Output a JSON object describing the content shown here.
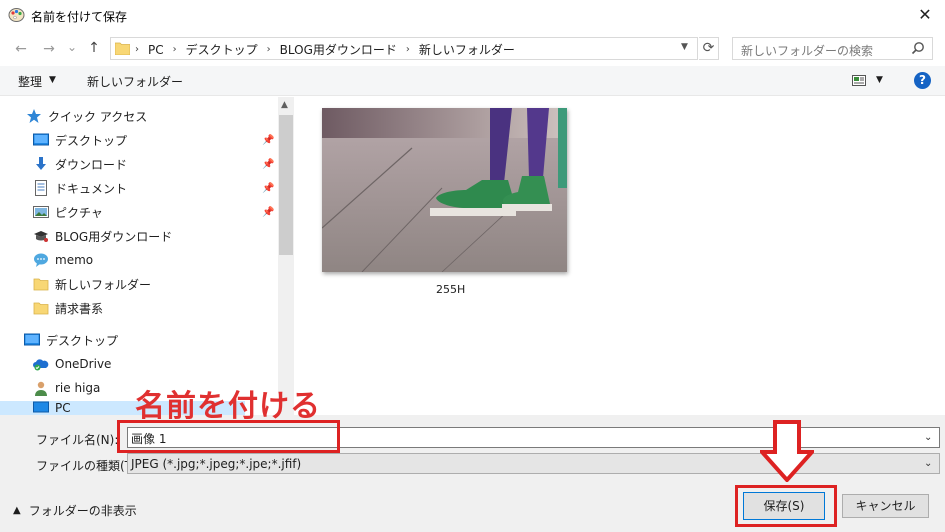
{
  "window": {
    "title": "名前を付けて保存",
    "close_glyph": "✕"
  },
  "nav": {
    "back_glyph": "←",
    "forward_glyph": "→",
    "recent_glyph": "⌄",
    "up_glyph": "↑",
    "address": {
      "crumbs": [
        "PC",
        "デスクトップ",
        "BLOG用ダウンロード",
        "新しいフォルダー"
      ]
    },
    "refresh_glyph": "⟳",
    "search_placeholder": "新しいフォルダーの検索"
  },
  "toolbar": {
    "organize_label": "整理",
    "new_folder_label": "新しいフォルダー",
    "help_label": "?"
  },
  "navpane": {
    "quick_access": "クイック アクセス",
    "quick_items": [
      {
        "label": "デスクトップ",
        "icon": "desktop-icon",
        "pinned": true
      },
      {
        "label": "ダウンロード",
        "icon": "download-icon",
        "pinned": true
      },
      {
        "label": "ドキュメント",
        "icon": "document-icon",
        "pinned": true
      },
      {
        "label": "ピクチャ",
        "icon": "pictures-icon",
        "pinned": true
      },
      {
        "label": "BLOG用ダウンロード",
        "icon": "blog-folder-icon",
        "pinned": false
      },
      {
        "label": "memo",
        "icon": "chat-icon",
        "pinned": false
      },
      {
        "label": "新しいフォルダー",
        "icon": "folder-icon",
        "pinned": false
      },
      {
        "label": "請求書系",
        "icon": "folder-icon",
        "pinned": false
      }
    ],
    "root_items": [
      {
        "label": "デスクトップ",
        "icon": "desktop-icon"
      },
      {
        "label": "OneDrive",
        "icon": "onedrive-icon"
      },
      {
        "label": "rie higa",
        "icon": "user-icon"
      },
      {
        "label": "PC",
        "icon": "pc-icon"
      }
    ]
  },
  "content": {
    "files": [
      {
        "name": "255H"
      }
    ]
  },
  "form": {
    "filename_label": "ファイル名(N):",
    "filename_value": "画像 1",
    "filetype_label": "ファイルの種類(T):",
    "filetype_value": "JPEG (*.jpg;*.jpeg;*.jpe;*.jfif)",
    "hide_folders_label": "フォルダーの非表示",
    "save_label": "保存(S)",
    "cancel_label": "キャンセル"
  },
  "annotation": {
    "text": "名前を付ける",
    "color": "#e03030"
  }
}
